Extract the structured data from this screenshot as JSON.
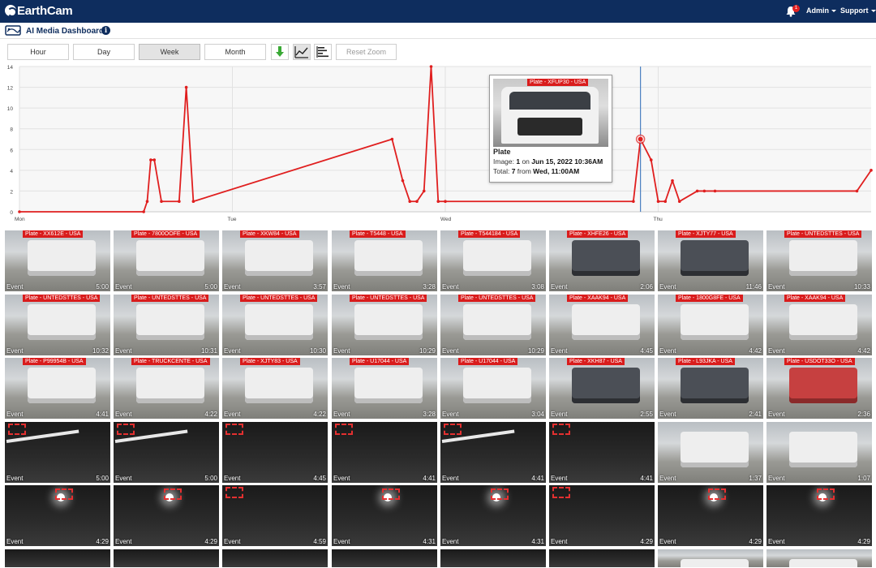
{
  "header": {
    "logo": "EarthCam",
    "notification_count": "1",
    "admin_label": "Admin",
    "support_label": "Support"
  },
  "subheader": {
    "title": "AI Media Dashboard",
    "info_glyph": "i"
  },
  "toolbar": {
    "hour": "Hour",
    "day": "Day",
    "week": "Week",
    "month": "Month",
    "reset_zoom": "Reset Zoom",
    "active": "Week"
  },
  "colors": {
    "header_bg": "#0e2d5e",
    "series": "#e01f1f",
    "crosshair": "#4a7fc0",
    "plate_tag": "#d91c1c"
  },
  "chart_data": {
    "type": "line",
    "xlabel": "",
    "ylabel": "",
    "ylim": [
      0,
      14
    ],
    "yticks": [
      0,
      2,
      4,
      6,
      8,
      10,
      12,
      14
    ],
    "xtick_labels": [
      "Mon",
      "Tue",
      "Wed",
      "Thu"
    ],
    "grid": true,
    "series": [
      {
        "x": [
          0,
          35,
          36,
          37,
          38,
          40,
          45,
          47,
          49,
          105,
          108,
          110,
          112,
          114,
          116,
          118,
          120,
          173,
          175,
          178,
          180,
          182,
          184,
          186,
          191,
          193,
          196,
          236,
          240
        ],
        "values": [
          0,
          0,
          1,
          5,
          5,
          1,
          1,
          12,
          1,
          7,
          3,
          1,
          1,
          2,
          14,
          1,
          1,
          1,
          7,
          5,
          1,
          1,
          3,
          1,
          2,
          2,
          2,
          2,
          4
        ]
      }
    ],
    "tooltip": {
      "plate_label": "Plate - XFUP30 - USA",
      "title": "Plate",
      "image_prefix": "Image: ",
      "image_num": "1",
      "image_on": " on ",
      "image_date": "Jun 15, 2022 10:36AM",
      "total_prefix": "Total: ",
      "total_num": "7",
      "total_from": " from ",
      "total_when": "Wed, 11:00AM",
      "x": 175,
      "value": 7
    }
  },
  "thumbnails": [
    [
      {
        "plate": "Plate - XX612E - USA",
        "dur": "5:00",
        "kind": "day",
        "veh": "light"
      },
      {
        "plate": "Plate - 7800OOFE - USA",
        "dur": "5:00",
        "kind": "day",
        "veh": "light"
      },
      {
        "plate": "Plate - XKW84 - USA",
        "dur": "3:57",
        "kind": "day",
        "veh": "light"
      },
      {
        "plate": "Plate - T5448 - USA",
        "dur": "3:28",
        "kind": "day",
        "veh": "light"
      },
      {
        "plate": "Plate - T544184 - USA",
        "dur": "3:08",
        "kind": "day",
        "veh": "light"
      },
      {
        "plate": "Plate - XHFE26 - USA",
        "dur": "2:06",
        "kind": "day",
        "veh": "dark"
      },
      {
        "plate": "Plate - XJTY77 - USA",
        "dur": "11:46",
        "kind": "day",
        "veh": "dark"
      },
      {
        "plate": "Plate - UNTEDSTTES - USA",
        "dur": "10:33",
        "kind": "day",
        "veh": "light"
      }
    ],
    [
      {
        "plate": "Plate - UNTEDSTTES - USA",
        "dur": "10:32",
        "kind": "day",
        "veh": "light"
      },
      {
        "plate": "Plate - UNTEDSTTES - USA",
        "dur": "10:31",
        "kind": "day",
        "veh": "light"
      },
      {
        "plate": "Plate - UNTEDSTTES - USA",
        "dur": "10:30",
        "kind": "day",
        "veh": "light"
      },
      {
        "plate": "Plate - UNTEDSTTES - USA",
        "dur": "10:29",
        "kind": "day",
        "veh": "light"
      },
      {
        "plate": "Plate - UNTEDSTTES - USA",
        "dur": "10:29",
        "kind": "day",
        "veh": "light"
      },
      {
        "plate": "Plate - XAAK94 - USA",
        "dur": "4:45",
        "kind": "day",
        "veh": "light"
      },
      {
        "plate": "Plate - 1800G8FE - USA",
        "dur": "4:42",
        "kind": "day",
        "veh": "light"
      },
      {
        "plate": "Plate - XAAK94 - USA",
        "dur": "4:42",
        "kind": "day",
        "veh": "light"
      }
    ],
    [
      {
        "plate": "Plate - P99954B - USA",
        "dur": "4:41",
        "kind": "day",
        "veh": "light"
      },
      {
        "plate": "Plate - TRUCKCENTE - USA",
        "dur": "4:22",
        "kind": "day",
        "veh": "light"
      },
      {
        "plate": "Plate - XJTY83 - USA",
        "dur": "4:22",
        "kind": "day",
        "veh": "light"
      },
      {
        "plate": "Plate - U17044 - USA",
        "dur": "3:28",
        "kind": "day",
        "veh": "light"
      },
      {
        "plate": "Plate - U17044 - USA",
        "dur": "3:04",
        "kind": "day",
        "veh": "light"
      },
      {
        "plate": "Plate - XKH87 - USA",
        "dur": "2:55",
        "kind": "day",
        "veh": "dark"
      },
      {
        "plate": "Plate - L93JKA - USA",
        "dur": "2:41",
        "kind": "day",
        "veh": "dark"
      },
      {
        "plate": "Plate - USDOT33O - USA",
        "dur": "2:36",
        "kind": "day",
        "veh": "red"
      }
    ],
    [
      {
        "plate": "",
        "dur": "5:00",
        "kind": "night",
        "veh": "streak"
      },
      {
        "plate": "",
        "dur": "5:00",
        "kind": "night",
        "veh": "streak"
      },
      {
        "plate": "",
        "dur": "4:45",
        "kind": "night",
        "veh": "none"
      },
      {
        "plate": "",
        "dur": "4:41",
        "kind": "night",
        "veh": "none"
      },
      {
        "plate": "",
        "dur": "4:41",
        "kind": "night",
        "veh": "streak"
      },
      {
        "plate": "",
        "dur": "4:41",
        "kind": "night",
        "veh": "none"
      },
      {
        "plate": "",
        "dur": "1:37",
        "kind": "day",
        "veh": "light"
      },
      {
        "plate": "",
        "dur": "1:07",
        "kind": "day",
        "veh": "light"
      }
    ],
    [
      {
        "plate": "",
        "dur": "4:29",
        "kind": "night",
        "veh": "glow"
      },
      {
        "plate": "",
        "dur": "4:29",
        "kind": "night",
        "veh": "glow"
      },
      {
        "plate": "",
        "dur": "4:59",
        "kind": "night",
        "veh": "none"
      },
      {
        "plate": "",
        "dur": "4:31",
        "kind": "night",
        "veh": "glow"
      },
      {
        "plate": "",
        "dur": "4:31",
        "kind": "night",
        "veh": "glow"
      },
      {
        "plate": "",
        "dur": "4:29",
        "kind": "night",
        "veh": "none"
      },
      {
        "plate": "",
        "dur": "4:29",
        "kind": "night",
        "veh": "glow"
      },
      {
        "plate": "",
        "dur": "4:29",
        "kind": "night",
        "veh": "glow"
      }
    ],
    [
      {
        "plate": "",
        "dur": "",
        "kind": "night",
        "veh": "none"
      },
      {
        "plate": "",
        "dur": "",
        "kind": "night",
        "veh": "none"
      },
      {
        "plate": "",
        "dur": "",
        "kind": "night",
        "veh": "none"
      },
      {
        "plate": "",
        "dur": "",
        "kind": "night",
        "veh": "none"
      },
      {
        "plate": "",
        "dur": "",
        "kind": "night",
        "veh": "none"
      },
      {
        "plate": "",
        "dur": "",
        "kind": "night",
        "veh": "none"
      },
      {
        "plate": "",
        "dur": "",
        "kind": "day",
        "veh": "light"
      },
      {
        "plate": "",
        "dur": "",
        "kind": "day",
        "veh": "light"
      }
    ]
  ],
  "event_label": "Event"
}
